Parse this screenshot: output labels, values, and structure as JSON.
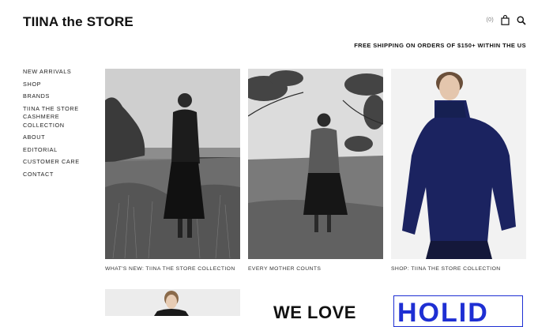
{
  "header": {
    "logo": "TIINA the STORE",
    "cart_count": "(0)",
    "icons": [
      "bag-icon",
      "search-icon"
    ]
  },
  "banner": {
    "shipping": "FREE SHIPPING ON ORDERS OF $150+ WITHIN THE US"
  },
  "sidebar": {
    "items": [
      {
        "label": "NEW ARRIVALS"
      },
      {
        "label": "SHOP"
      },
      {
        "label": "BRANDS"
      },
      {
        "label": "TIINA THE STORE CASHMERE COLLECTION"
      },
      {
        "label": "ABOUT"
      },
      {
        "label": "EDITORIAL"
      },
      {
        "label": "CUSTOMER CARE"
      },
      {
        "label": "CONTACT"
      }
    ]
  },
  "tiles": [
    {
      "caption": "WHAT'S NEW: TIINA THE STORE COLLECTION"
    },
    {
      "caption": "EVERY MOTHER COUNTS"
    },
    {
      "caption": "SHOP: TIINA THE STORE COLLECTION"
    }
  ],
  "promos": {
    "we_love": "WE LOVE",
    "holiday": "HOLID"
  },
  "colors": {
    "accent_blue": "#1e2fd3",
    "navy_sweater": "#1b2360",
    "text": "#111111"
  }
}
